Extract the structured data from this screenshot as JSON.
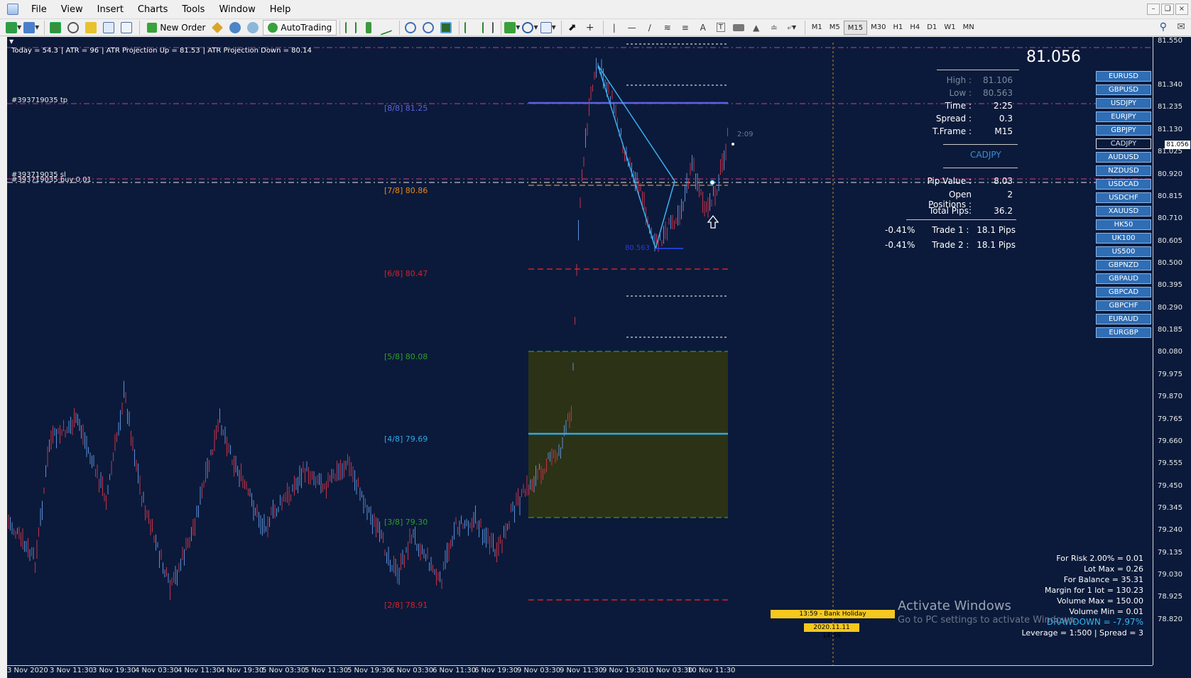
{
  "window": {
    "menus": [
      "File",
      "View",
      "Insert",
      "Charts",
      "Tools",
      "Window",
      "Help"
    ]
  },
  "toolbar": {
    "new_order_label": "New Order",
    "autotrading_label": "AutoTrading",
    "timeframes": [
      "M1",
      "M5",
      "M15",
      "M30",
      "H1",
      "H4",
      "D1",
      "W1",
      "MN"
    ],
    "active_timeframe": "M15"
  },
  "chart": {
    "info_strip": {
      "today": "Today = 54.3",
      "atr": "ATR = 96",
      "atr_up": "ATR Projection Up = 81.53",
      "atr_down": "ATR Projection Down = 80.14"
    },
    "order_lines": {
      "tp": "#393719035 tp",
      "sl": "#393719035 sl",
      "buy": "#393719035 buy 0.01"
    },
    "murrey_levels": [
      {
        "label": "[8/8]",
        "value": "81.25",
        "color": "#5b63e0"
      },
      {
        "label": "[7/8]",
        "value": "80.86",
        "color": "#e8891b"
      },
      {
        "label": "[6/8]",
        "value": "80.47",
        "color": "#d81f2a"
      },
      {
        "label": "[5/8]",
        "value": "80.08",
        "color": "#2e9d2e"
      },
      {
        "label": "[4/8]",
        "value": "79.69",
        "color": "#2fa8e9"
      },
      {
        "label": "[3/8]",
        "value": "79.30",
        "color": "#2e9d2e"
      },
      {
        "label": "[2/8]",
        "value": "78.91",
        "color": "#d81f2a"
      }
    ],
    "low_marker": "80.563",
    "timer": "2:09",
    "current_price_tag": "81.056",
    "y_axis": [
      "81.550",
      "81.340",
      "81.235",
      "81.130",
      "81.025",
      "80.920",
      "80.815",
      "80.710",
      "80.605",
      "80.500",
      "80.395",
      "80.290",
      "80.185",
      "80.080",
      "79.975",
      "79.870",
      "79.765",
      "79.660",
      "79.555",
      "79.450",
      "79.345",
      "79.240",
      "79.135",
      "79.030",
      "78.925",
      "78.820"
    ],
    "x_axis": [
      "3 Nov 2020",
      "3 Nov 11:30",
      "3 Nov 19:30",
      "4 Nov 03:30",
      "4 Nov 11:30",
      "4 Nov 19:30",
      "5 Nov 03:30",
      "5 Nov 11:30",
      "5 Nov 19:30",
      "6 Nov 03:30",
      "6 Nov 11:30",
      "6 Nov 19:30",
      "9 Nov 03:30",
      "9 Nov 11:30",
      "9 Nov 19:30",
      "10 Nov 03:30",
      "10 Nov 11:30"
    ],
    "holiday": "13:59 - Bank Holiday",
    "date_box": "2020.11.11 14:59",
    "watermark_title": "Activate Windows",
    "watermark_sub": "Go to PC settings to activate Windows."
  },
  "panel": {
    "price": "81.056",
    "high_label": "High :",
    "high": "81.106",
    "low_label": "Low :",
    "low": "80.563",
    "time_label": "Time :",
    "time": "2:25",
    "spread_label": "Spread :",
    "spread": "0.3",
    "tframe_label": "T.Frame :",
    "tframe": "M15",
    "symbol": "CADJPY",
    "pip_value_label": "Pip Value :",
    "pip_value": "8.03",
    "open_positions_label": "Open Positions :",
    "open_positions": "2",
    "total_pips_label": "Total Pips:",
    "total_pips": "36.2",
    "trades": [
      {
        "pct": "-0.41%",
        "label": "Trade 1 :",
        "pips": "18.1 Pips"
      },
      {
        "pct": "-0.41%",
        "label": "Trade 2 :",
        "pips": "18.1 Pips"
      }
    ]
  },
  "symbols": [
    "EURUSD",
    "GBPUSD",
    "USDJPY",
    "EURJPY",
    "GBPJPY",
    "CADJPY",
    "AUDUSD",
    "NZDUSD",
    "USDCAD",
    "USDCHF",
    "XAUUSD",
    "HK50",
    "UK100",
    "US500",
    "GBPNZD",
    "GBPAUD",
    "GBPCAD",
    "GBPCHF",
    "EURAUD",
    "EURGBP"
  ],
  "active_symbol": "CADJPY",
  "risk": {
    "for_risk": "For Risk 2.00% = 0.01",
    "lot_max": "Lot Max = 0.26",
    "for_balance": "For Balance = 35.31",
    "margin": "Margin for 1 lot = 130.23",
    "volume_max": "Volume Max = 150.00",
    "volume_min": "Volume Min = 0.01",
    "drawdown": "DRAWDOWN = -7.97%",
    "leverage": "Leverage = 1:500 | Spread = 3"
  },
  "colors": {
    "chart_bg": "#0b1a3a",
    "bull": "#5b8fd6",
    "bear": "#c8324a",
    "pink_line": "#d43a8c",
    "zone_fill": "#2c3215"
  }
}
